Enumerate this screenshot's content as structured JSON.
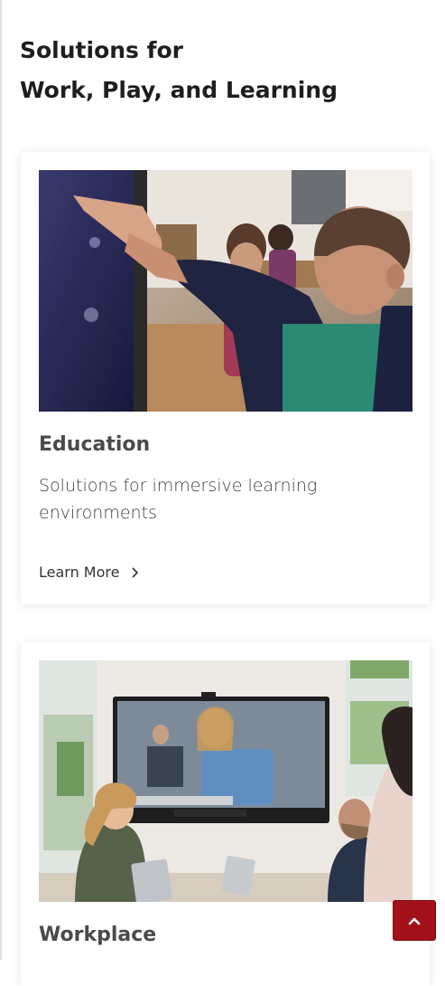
{
  "section": {
    "heading_line1": "Solutions for",
    "heading_line2": "Work, Play, and Learning"
  },
  "cards": [
    {
      "title": "Education",
      "description": "Solutions for immersive learning environments",
      "link_label": "Learn More",
      "image_icon": "classroom-photo"
    },
    {
      "title": "Workplace",
      "image_icon": "meeting-room-photo"
    }
  ],
  "back_to_top": {
    "icon": "chevron-up-icon",
    "color": "#a3111b"
  }
}
